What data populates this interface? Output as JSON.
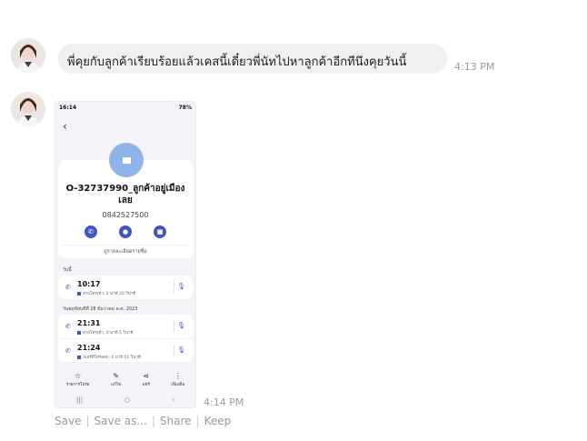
{
  "messages": [
    {
      "type": "text",
      "text": "พี่คุยกับลูกค้าเรียบร้อยแล้วเคสนี้เดี๋ยวพี่นัทไปหาลูกค้าอีกทีนึงคุยวันนี้",
      "time": "4:13 PM"
    },
    {
      "type": "image",
      "time": "4:14 PM",
      "screenshot": {
        "status_time": "16:14",
        "status_right": "78%",
        "contact_name": "O-32737990_ลูกค้าอยู่เมืองเลย",
        "contact_number": "0842527500",
        "contact_detail_link": "ดูรายละเอียดรายชื่อ",
        "sections": [
          {
            "header": "วันนี้",
            "calls": [
              {
                "time": "10:17",
                "detail": "สายโทรเข้า, 2 นาที 20 วินาที"
              }
            ]
          },
          {
            "header": "วันพฤหัสบดีที่ 28 ธันวาคม ค.ศ. 2023",
            "calls": [
              {
                "time": "21:31",
                "detail": "สายโทรเข้า, 0 นาที 5 วินาที"
              },
              {
                "time": "21:24",
                "detail": "เบอร์ที่โทรออก, 4 นาที 51 วินาที"
              }
            ]
          }
        ],
        "toolbar": [
          {
            "icon": "star-icon",
            "label": "รายการโปรด"
          },
          {
            "icon": "pencil-icon",
            "label": "แก้ไข"
          },
          {
            "icon": "share-icon",
            "label": "แชร์"
          },
          {
            "icon": "more-icon",
            "label": "เพิ่มเติม"
          }
        ]
      }
    }
  ],
  "actions": [
    "Save",
    "Save as...",
    "Share",
    "Keep"
  ]
}
